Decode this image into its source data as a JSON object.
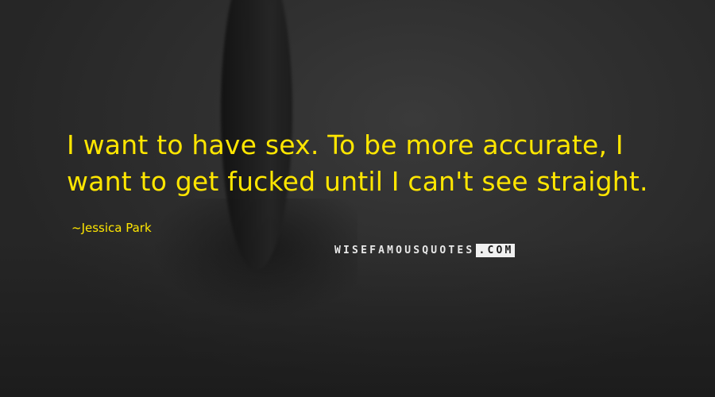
{
  "quote": {
    "text": "I want to have sex. To be more accurate, I want to get fucked until I can't see straight.",
    "author": "Jessica Park",
    "color": "#ffe600"
  },
  "watermark": {
    "part1": "WISEFAMOUSQUOTES",
    "part2": ".COM"
  }
}
